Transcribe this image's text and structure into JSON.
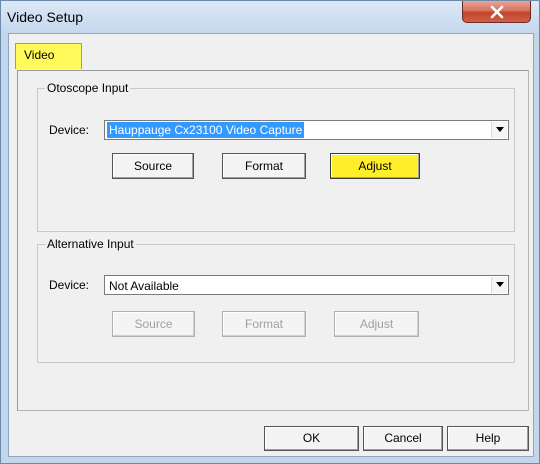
{
  "window": {
    "title": "Video Setup"
  },
  "tabs": [
    {
      "label": "Video"
    }
  ],
  "otoscope_input": {
    "group_label": "Otoscope Input",
    "device_label": "Device:",
    "device_value": "Hauppauge Cx23100 Video Capture",
    "buttons": {
      "source": "Source",
      "format": "Format",
      "adjust": "Adjust"
    }
  },
  "alternative_input": {
    "group_label": "Alternative Input",
    "device_label": "Device:",
    "device_value": "Not Available",
    "buttons": {
      "source": "Source",
      "format": "Format",
      "adjust": "Adjust"
    }
  },
  "footer": {
    "ok": "OK",
    "cancel": "Cancel",
    "help": "Help"
  },
  "colors": {
    "highlight": "#ffef2b",
    "selection": "#3399ff",
    "close_button": "#c2442b"
  }
}
